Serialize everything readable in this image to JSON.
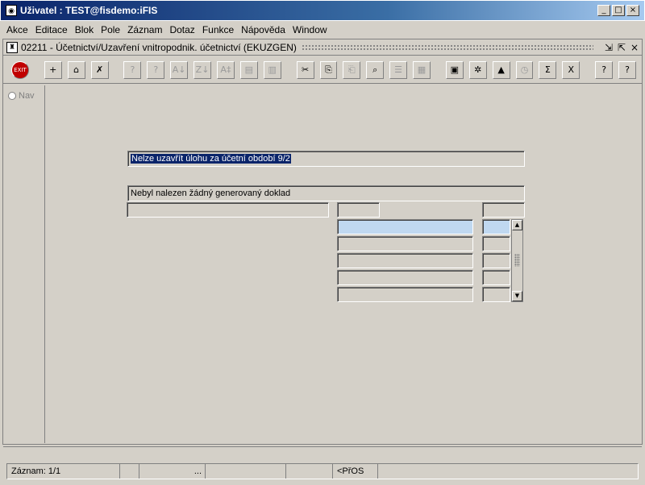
{
  "window": {
    "title": "Uživatel : TEST@fisdemo:iFIS",
    "controls": [
      "_",
      "□",
      "×"
    ]
  },
  "menu": {
    "items": [
      "Akce",
      "Editace",
      "Blok",
      "Pole",
      "Záznam",
      "Dotaz",
      "Funkce",
      "Nápověda",
      "Window"
    ]
  },
  "form": {
    "title": "02211 - Účetnictví/Uzavření vnitropodnik. účetnictví (EKUZGEN)",
    "controls": [
      "⇲",
      "⇱",
      "×"
    ]
  },
  "toolbar": {
    "buttons": [
      {
        "name": "exit-button",
        "glyph": "EXIT",
        "enabled": true
      },
      {
        "name": "insert-record-button",
        "glyph": "+",
        "enabled": true
      },
      {
        "name": "save-button",
        "glyph": "⌂",
        "enabled": true
      },
      {
        "name": "delete-record-button",
        "glyph": "✗",
        "enabled": true
      },
      {
        "name": "query-enter-button",
        "glyph": "?",
        "enabled": false
      },
      {
        "name": "query-execute-button",
        "glyph": "?",
        "enabled": false
      },
      {
        "name": "sort-asc-button",
        "glyph": "A↓",
        "enabled": false
      },
      {
        "name": "sort-desc-button",
        "glyph": "Z↓",
        "enabled": false
      },
      {
        "name": "sort-custom-button",
        "glyph": "A‡",
        "enabled": false
      },
      {
        "name": "print-button",
        "glyph": "▤",
        "enabled": false
      },
      {
        "name": "print-preview-button",
        "glyph": "▥",
        "enabled": false
      },
      {
        "name": "cut-button",
        "glyph": "✂",
        "enabled": true
      },
      {
        "name": "copy-button",
        "glyph": "⎘",
        "enabled": true
      },
      {
        "name": "paste-button",
        "glyph": "⎗",
        "enabled": false
      },
      {
        "name": "find-button",
        "glyph": "⌕",
        "enabled": true
      },
      {
        "name": "list-button",
        "glyph": "☰",
        "enabled": false
      },
      {
        "name": "grid-button",
        "glyph": "▦",
        "enabled": false
      },
      {
        "name": "calculator-button",
        "glyph": "▣",
        "enabled": true
      },
      {
        "name": "settings-button",
        "glyph": "✲",
        "enabled": true
      },
      {
        "name": "chart-button",
        "glyph": "▲",
        "enabled": true
      },
      {
        "name": "clock-button",
        "glyph": "◷",
        "enabled": false
      },
      {
        "name": "sum-button",
        "glyph": "Σ",
        "enabled": true
      },
      {
        "name": "excel-button",
        "glyph": "X",
        "enabled": true
      },
      {
        "name": "help-button",
        "glyph": "?",
        "enabled": true
      },
      {
        "name": "context-help-button",
        "glyph": "?",
        "enabled": true
      }
    ]
  },
  "nav": {
    "label": "Nav"
  },
  "content": {
    "error_message": "Nelze uzavřít úlohu za účetní období 9/2",
    "info_message": "Nebyl nalezen žádný generovaný doklad"
  },
  "statusbar": {
    "record": "Záznam: 1/1",
    "cell3": "...",
    "cell6": "<PřOS"
  }
}
